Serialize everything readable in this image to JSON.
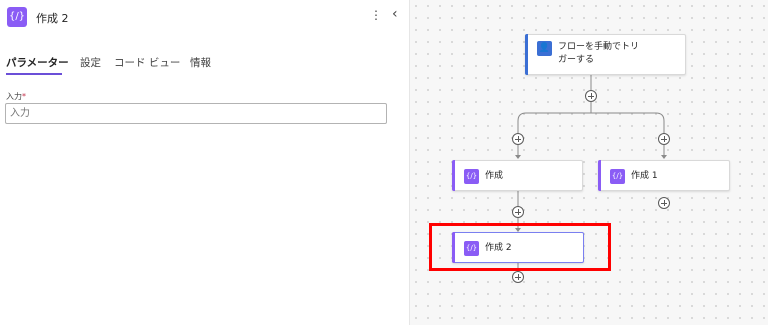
{
  "panel": {
    "title": "作成 2",
    "icon": "compose-icon",
    "more_icon": "more-vertical-icon",
    "collapse_icon": "chevron-left-icon",
    "tabs": [
      {
        "label": "パラメーター",
        "active": true
      },
      {
        "label": "設定",
        "active": false
      },
      {
        "label": "コード ビュー",
        "active": false
      },
      {
        "label": "情報",
        "active": false
      }
    ],
    "input": {
      "label": "入力",
      "required_mark": "*",
      "placeholder": "入力",
      "value": ""
    }
  },
  "flow": {
    "trigger": {
      "label_line1": "フローを手動でトリ",
      "label_line2": "ガーする",
      "icon": "manual-trigger-icon"
    },
    "branch_left": {
      "label": "作成",
      "icon": "compose-icon"
    },
    "branch_right": {
      "label": "作成 1",
      "icon": "compose-icon"
    },
    "selected_action": {
      "label": "作成 2",
      "icon": "compose-icon"
    }
  },
  "colors": {
    "accent": "#8a5cf5",
    "trigger": "#3b6fd4",
    "tab_underline": "#6b4fd8",
    "highlight": "#ff0000"
  }
}
